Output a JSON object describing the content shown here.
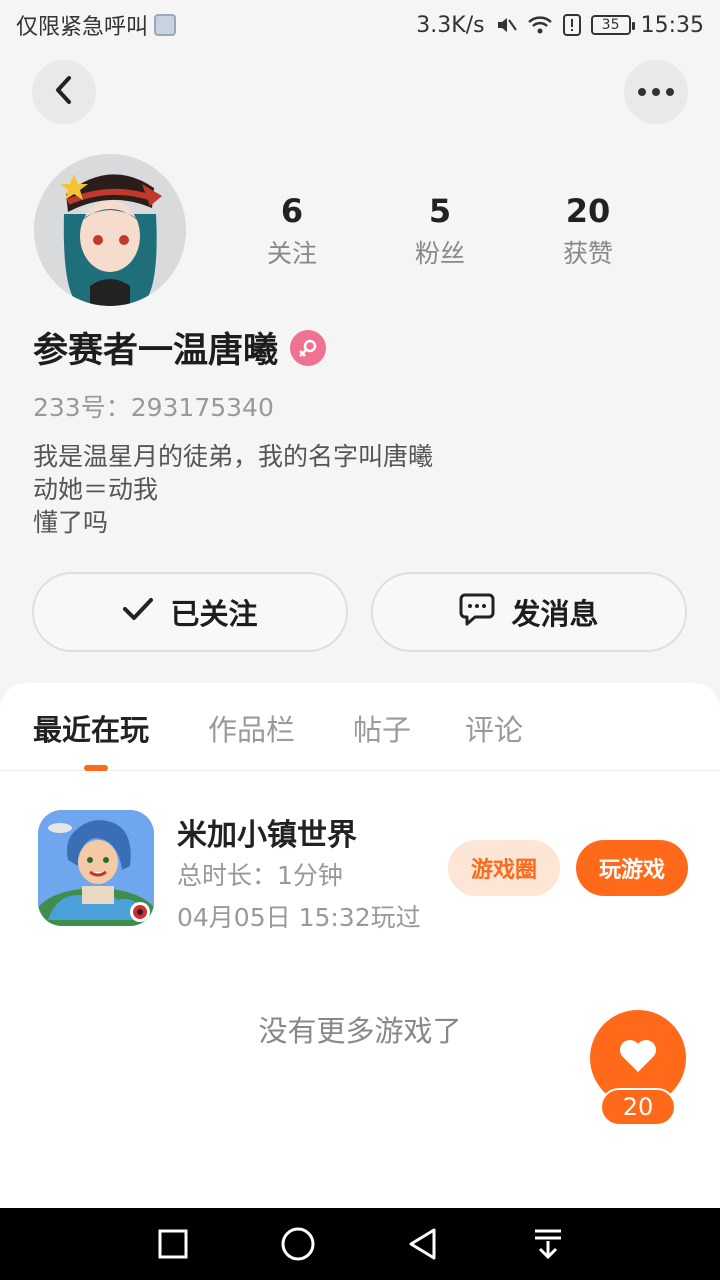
{
  "status_bar": {
    "carrier": "仅限紧急呼叫",
    "speed": "3.3K/s",
    "battery": "35",
    "time": "15:35"
  },
  "profile": {
    "username": "参赛者一温唐曦",
    "user_id": "233号：293175340",
    "bio_lines": [
      "我是温星月的徒弟，我的名字叫唐曦",
      "动她＝动我",
      "懂了吗"
    ],
    "stats": [
      {
        "value": "6",
        "label": "关注"
      },
      {
        "value": "5",
        "label": "粉丝"
      },
      {
        "value": "20",
        "label": "获赞"
      }
    ],
    "follow_label": "已关注",
    "message_label": "发消息"
  },
  "tabs": [
    {
      "label": "最近在玩",
      "active": true
    },
    {
      "label": "作品栏",
      "active": false
    },
    {
      "label": "帖子",
      "active": false
    },
    {
      "label": "评论",
      "active": false
    }
  ],
  "game": {
    "title": "米加小镇世界",
    "duration": "总时长：1分钟",
    "last_played": "04月05日 15:32玩过",
    "circle_label": "游戏圈",
    "play_label": "玩游戏"
  },
  "no_more_text": "没有更多游戏了",
  "like_count": "20",
  "colors": {
    "accent": "#ff6a1a",
    "gender": "#f07293"
  }
}
